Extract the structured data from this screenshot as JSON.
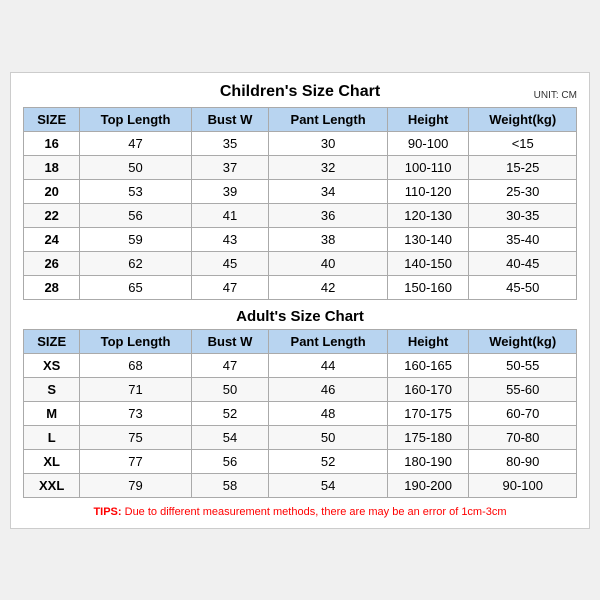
{
  "children_chart": {
    "title": "Children's Size Chart",
    "unit": "UNIT: CM",
    "headers": [
      "SIZE",
      "Top Length",
      "Bust W",
      "Pant Length",
      "Height",
      "Weight(kg)"
    ],
    "rows": [
      [
        "16",
        "47",
        "35",
        "30",
        "90-100",
        "<15"
      ],
      [
        "18",
        "50",
        "37",
        "32",
        "100-110",
        "15-25"
      ],
      [
        "20",
        "53",
        "39",
        "34",
        "110-120",
        "25-30"
      ],
      [
        "22",
        "56",
        "41",
        "36",
        "120-130",
        "30-35"
      ],
      [
        "24",
        "59",
        "43",
        "38",
        "130-140",
        "35-40"
      ],
      [
        "26",
        "62",
        "45",
        "40",
        "140-150",
        "40-45"
      ],
      [
        "28",
        "65",
        "47",
        "42",
        "150-160",
        "45-50"
      ]
    ]
  },
  "adults_chart": {
    "title": "Adult's Size Chart",
    "headers": [
      "SIZE",
      "Top Length",
      "Bust W",
      "Pant Length",
      "Height",
      "Weight(kg)"
    ],
    "rows": [
      [
        "XS",
        "68",
        "47",
        "44",
        "160-165",
        "50-55"
      ],
      [
        "S",
        "71",
        "50",
        "46",
        "160-170",
        "55-60"
      ],
      [
        "M",
        "73",
        "52",
        "48",
        "170-175",
        "60-70"
      ],
      [
        "L",
        "75",
        "54",
        "50",
        "175-180",
        "70-80"
      ],
      [
        "XL",
        "77",
        "56",
        "52",
        "180-190",
        "80-90"
      ],
      [
        "XXL",
        "79",
        "58",
        "54",
        "190-200",
        "90-100"
      ]
    ]
  },
  "tips": {
    "label": "TIPS:",
    "text": "Due to different measurement methods, there are may be an error of 1cm-3cm"
  }
}
